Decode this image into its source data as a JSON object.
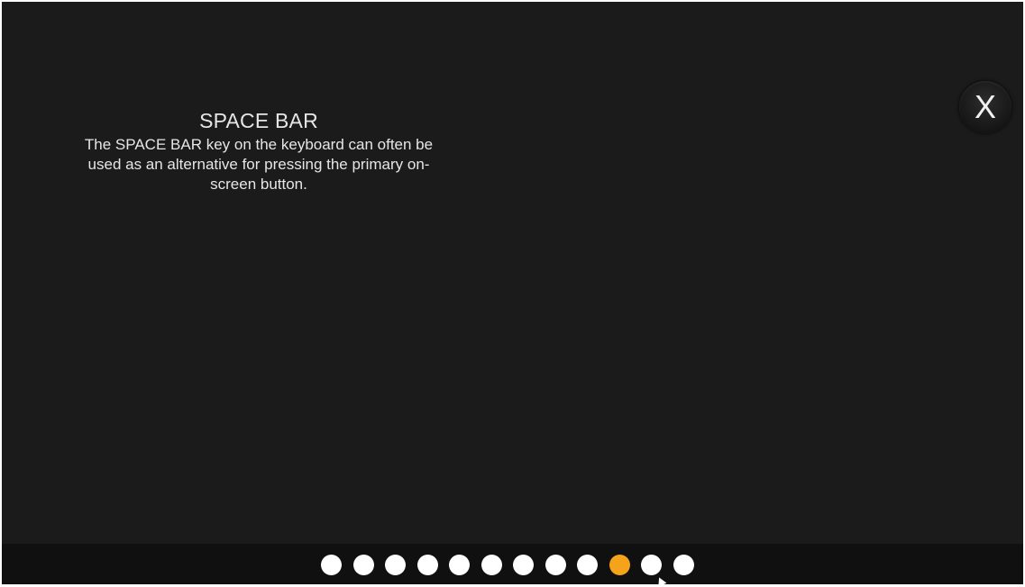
{
  "tip": {
    "title": "SPACE BAR",
    "body": "The SPACE BAR key on the keyboard can often be used as an alternative for pressing the primary on-screen button."
  },
  "close_button": {
    "label": "X",
    "icon": "close-icon"
  },
  "pagination": {
    "total": 12,
    "current": 10,
    "dot_color": "#ffffff",
    "active_color": "#f5a31a"
  },
  "colors": {
    "background": "#1b1b1b",
    "footer": "#101010",
    "text": "#e6e6e6"
  }
}
